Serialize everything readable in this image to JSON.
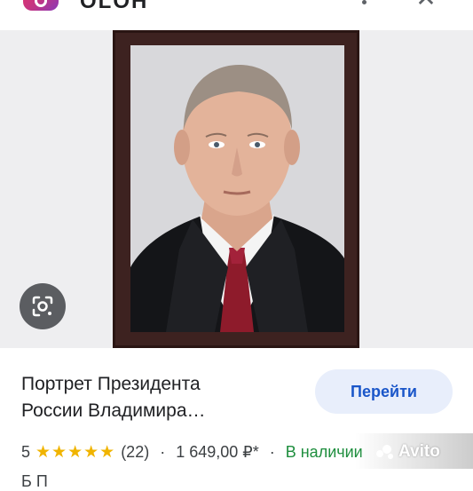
{
  "header": {
    "app_name": "OLOH",
    "icons": [
      "app-icon",
      "more-vert-icon",
      "close-icon"
    ]
  },
  "image": {
    "subject": "portrait-photo-in-frame",
    "lens_icon": "google-lens-icon"
  },
  "product": {
    "title_line1": "Портрет Президента",
    "title_line2": "России Владимира…",
    "go_button": "Перейти",
    "rating": "5",
    "stars": "★★★★★",
    "reviews": "(22)",
    "separator": "·",
    "price": "1 649,00 ₽*",
    "stock": "В наличии",
    "next_line": "Б  П"
  },
  "watermark": {
    "text": "Avito"
  },
  "colors": {
    "accent_blue": "#1a56c9",
    "button_bg": "#e8eefb",
    "star_color": "#f0b400",
    "stock_green": "#1e8e3e",
    "frame_brown": "#3d2220"
  }
}
